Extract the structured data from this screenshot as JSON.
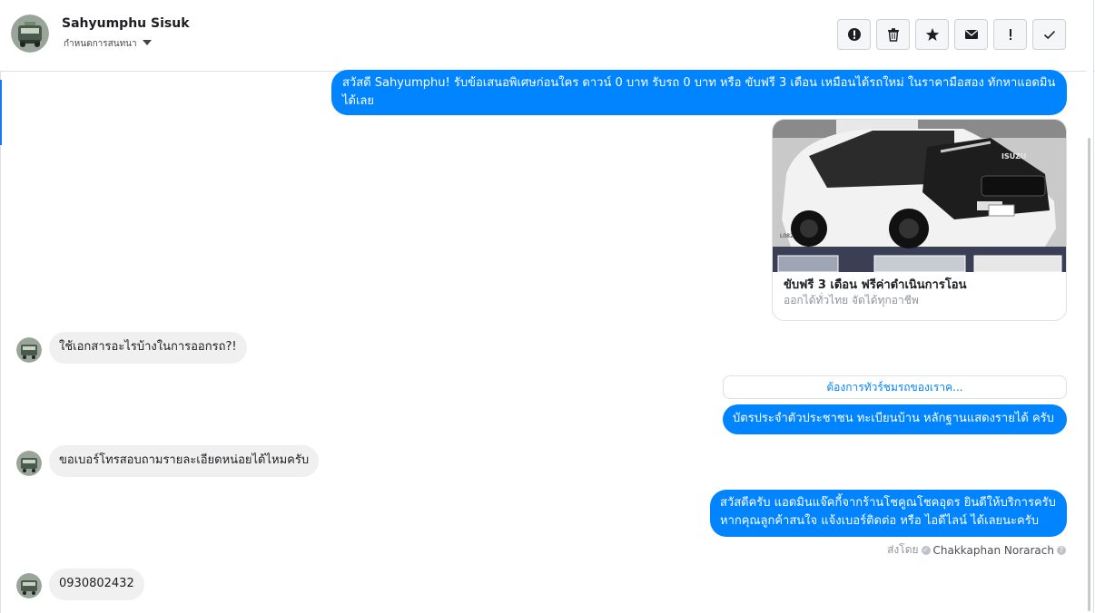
{
  "header": {
    "name": "Sahyumphu Sisuk",
    "subtitle": "กำหนดการสนทนา",
    "toolbar": [
      {
        "icon": "info-circle-icon"
      },
      {
        "icon": "trash-icon"
      },
      {
        "icon": "star-icon"
      },
      {
        "icon": "envelope-icon"
      },
      {
        "icon": "exclamation-icon"
      },
      {
        "icon": "check-icon"
      }
    ]
  },
  "messages": {
    "m1": "สวัสดี Sahyumphu! รับข้อเสนอพิเศษก่อนใคร ดาวน์ 0 บาท รับรถ 0 บาท หรือ ขับฟรี 3 เดือน เหมือนได้รถใหม่ ในราคามือสอง ทักหาแอดมินได้เลย",
    "card": {
      "title": "ขับฟรี 3 เดือน ฟรีค่าดำเนินการโอน",
      "subtitle": "ออกได้ทั่วไทย จัดได้ทุกอาชีพ",
      "brand": "ISUZU",
      "plate": "L082"
    },
    "m2": "ใช้เอกสารอะไรบ้างในการออกรถ?!",
    "quick_reply": "ต้องการทัวร์ชมรถของเราค...",
    "m3": "บัตรประจำตัวประชาชน ทะเบียนบ้าน หลักฐานแสดงรายได้ ครับ",
    "m4": "ขอเบอร์โทรสอบถามรายละเอียดหน่อยได้ไหมครับ",
    "m5": "สวัสดีครับ แอดมินแจ๊คกี้จากร้านโชคูณโชคอุดร ยินดีให้บริการครับ หากคุณลูกค้าสนใจ แจ้งเบอร์ติดต่อ หรือ ไอดีไลน์ ได้เลยนะครับ",
    "sent_by_label": "ส่งโดย",
    "sent_by_agent": "Chakkaphan Norarach",
    "m6": "0930802432"
  },
  "colors": {
    "outgoing": "#0084ff",
    "incoming": "#f0f0f0",
    "accent": "#1877f2"
  }
}
